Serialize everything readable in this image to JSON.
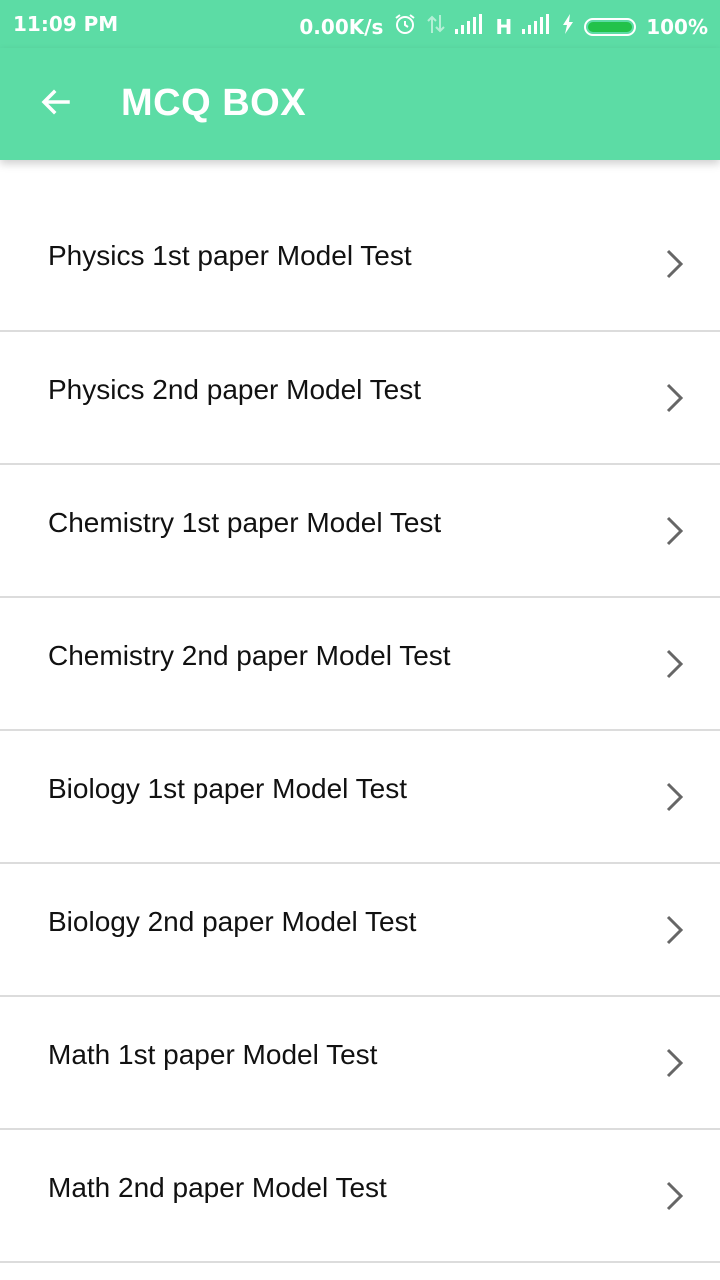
{
  "status_bar": {
    "time": "11:09 PM",
    "speed": "0.00K/s",
    "network_type": "H",
    "battery_percent": "100%",
    "battery_level": 1.0,
    "icons": [
      "alarm-icon",
      "data-transfer-icon",
      "signal-icon",
      "charging-icon",
      "battery-icon"
    ]
  },
  "app_bar": {
    "title": "MCQ BOX",
    "back_icon": "arrow-left-icon",
    "background_color": "#5cdca5"
  },
  "list": {
    "items": [
      {
        "label": "Physics 1st paper Model Test"
      },
      {
        "label": "Physics 2nd paper Model Test"
      },
      {
        "label": "Chemistry 1st paper Model Test"
      },
      {
        "label": "Chemistry 2nd paper Model Test"
      },
      {
        "label": "Biology 1st paper Model Test"
      },
      {
        "label": "Biology 2nd paper Model Test"
      },
      {
        "label": "Math 1st paper Model Test"
      },
      {
        "label": "Math 2nd paper Model Test"
      }
    ],
    "trailing_icon": "chevron-right-icon"
  }
}
